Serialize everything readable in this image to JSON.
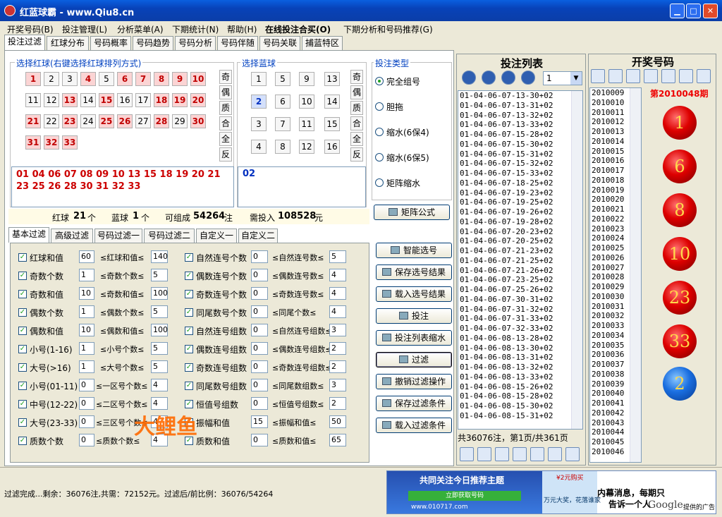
{
  "window": {
    "title": "红蓝球霸 - www.Qiu8.cn"
  },
  "menu": [
    "开奖号码(B)",
    "投注管理(L)",
    "分析菜单(A)",
    "下期统计(N)",
    "帮助(H)",
    "在线投注合买(O)",
    "下期分析和号码推荐(G)"
  ],
  "tabs": [
    "投注过滤",
    "红球分布",
    "号码概率",
    "号码趋势",
    "号码分析",
    "号码伴随",
    "号码关联",
    "捕蓝特区"
  ],
  "red_section": {
    "label": "选择红球(右键选择红球排列方式)",
    "numbers": [
      "1",
      "2",
      "3",
      "4",
      "5",
      "6",
      "7",
      "8",
      "9",
      "10",
      "11",
      "12",
      "13",
      "14",
      "15",
      "16",
      "17",
      "18",
      "19",
      "20",
      "21",
      "22",
      "23",
      "24",
      "25",
      "26",
      "27",
      "28",
      "29",
      "30",
      "31",
      "32",
      "33"
    ],
    "selected": [
      1,
      4,
      6,
      7,
      8,
      9,
      10,
      13,
      15,
      18,
      19,
      20,
      21,
      23,
      25,
      26,
      28,
      30,
      31,
      32,
      33
    ],
    "side_buttons": [
      "奇",
      "偶",
      "质",
      "合",
      "全",
      "反"
    ],
    "selected_text": "01 04 06 07 08 09 10 13 15 18 19 20 21 23 25 26 28 30 31 32 33"
  },
  "blue_section": {
    "label": "选择蓝球",
    "numbers": [
      "1",
      "5",
      "9",
      "13",
      "2",
      "6",
      "10",
      "14",
      "3",
      "7",
      "11",
      "15",
      "4",
      "8",
      "12",
      "16"
    ],
    "selected": [
      2
    ],
    "side_buttons": [
      "奇",
      "偶",
      "质",
      "合",
      "全",
      "反"
    ],
    "selected_text": "02"
  },
  "summary": {
    "red_label": "红球",
    "red_count": "21",
    "blue_label": "蓝球",
    "blue_count": "1",
    "unit_ge": "个",
    "combo_label": "可组成",
    "combo_count": "54264",
    "unit_zhu": "注",
    "need_label": "需投入",
    "need_amount": "108528",
    "unit_yuan": "元"
  },
  "bet_type": {
    "label": "投注类型",
    "options": [
      "完全组号",
      "胆拖",
      "缩水(6保4)",
      "缩水(6保5)",
      "矩阵缩水"
    ],
    "selected": 0,
    "matrix_button": "矩阵公式"
  },
  "filter_tabs": [
    "基本过滤",
    "高级过滤",
    "号码过滤一",
    "号码过滤二",
    "自定义一",
    "自定义二"
  ],
  "filters_left": [
    {
      "name": "红球和值",
      "min": "60",
      "mid": "≤红球和值≤",
      "max": "140"
    },
    {
      "name": "奇数个数",
      "min": "1",
      "mid": "≤奇数个数≤",
      "max": "5"
    },
    {
      "name": "奇数和值",
      "min": "10",
      "mid": "≤奇数和值≤",
      "max": "100"
    },
    {
      "name": "偶数个数",
      "min": "1",
      "mid": "≤偶数个数≤",
      "max": "5"
    },
    {
      "name": "偶数和值",
      "min": "10",
      "mid": "≤偶数和值≤",
      "max": "100"
    },
    {
      "name": "小号(1-16)",
      "min": "1",
      "mid": "≤小号个数≤",
      "max": "5"
    },
    {
      "name": "大号(>16)",
      "min": "1",
      "mid": "≤大号个数≤",
      "max": "5"
    },
    {
      "name": "小号(01-11)",
      "min": "0",
      "mid": "≤一区号个数≤",
      "max": "4"
    },
    {
      "name": "中号(12-22)",
      "min": "0",
      "mid": "≤二区号个数≤",
      "max": "4"
    },
    {
      "name": "大号(23-33)",
      "min": "0",
      "mid": "≤三区号个数≤",
      "max": "4"
    },
    {
      "name": "质数个数",
      "min": "0",
      "mid": "≤质数个数≤",
      "max": "4"
    }
  ],
  "filters_right": [
    {
      "name": "自然连号个数",
      "min": "0",
      "mid": "≤自然连号数≤",
      "max": "5"
    },
    {
      "name": "偶数连号个数",
      "min": "0",
      "mid": "≤偶数连号数≤",
      "max": "4"
    },
    {
      "name": "奇数连号个数",
      "min": "0",
      "mid": "≤奇数连号数≤",
      "max": "4"
    },
    {
      "name": "同尾数号个数",
      "min": "0",
      "mid": "≤同尾个数≤",
      "max": "4"
    },
    {
      "name": "自然连号组数",
      "min": "0",
      "mid": "≤自然连号组数≤",
      "max": "3"
    },
    {
      "name": "偶数连号组数",
      "min": "0",
      "mid": "≤偶数连号组数≤",
      "max": "2"
    },
    {
      "name": "奇数连号组数",
      "min": "0",
      "mid": "≤奇数连号组数≤",
      "max": "2"
    },
    {
      "name": "同尾数号组数",
      "min": "0",
      "mid": "≤同尾数组数≤",
      "max": "3"
    },
    {
      "name": "恒值号组数",
      "min": "0",
      "mid": "≤恒值号组数≤",
      "max": "2"
    },
    {
      "name": "振幅和值",
      "min": "15",
      "mid": "≤振幅和值≤",
      "max": "50"
    },
    {
      "name": "质数和值",
      "min": "0",
      "mid": "≤质数和值≤",
      "max": "65"
    }
  ],
  "action_buttons": [
    "智能选号",
    "保存选号结果",
    "载入选号结果",
    "投注",
    "投注列表缩水",
    "过滤",
    "撤销过滤操作",
    "保存过滤条件",
    "载入过滤条件"
  ],
  "watermark": "大鲤鱼",
  "bet_list": {
    "title": "投注列表",
    "page_select": "1",
    "items": [
      "01-04-06-07-13-30+02",
      "01-04-06-07-13-31+02",
      "01-04-06-07-13-32+02",
      "01-04-06-07-13-33+02",
      "01-04-06-07-15-28+02",
      "01-04-06-07-15-30+02",
      "01-04-06-07-15-31+02",
      "01-04-06-07-15-32+02",
      "01-04-06-07-15-33+02",
      "01-04-06-07-18-25+02",
      "01-04-06-07-19-23+02",
      "01-04-06-07-19-25+02",
      "01-04-06-07-19-26+02",
      "01-04-06-07-19-28+02",
      "01-04-06-07-20-23+02",
      "01-04-06-07-20-25+02",
      "01-04-06-07-21-23+02",
      "01-04-06-07-21-25+02",
      "01-04-06-07-21-26+02",
      "01-04-06-07-23-25+02",
      "01-04-06-07-25-26+02",
      "01-04-06-07-30-31+02",
      "01-04-06-07-31-32+02",
      "01-04-06-07-31-33+02",
      "01-04-06-07-32-33+02",
      "01-04-06-08-13-28+02",
      "01-04-06-08-13-30+02",
      "01-04-06-08-13-31+02",
      "01-04-06-08-13-32+02",
      "01-04-06-08-13-33+02",
      "01-04-06-08-15-26+02",
      "01-04-06-08-15-28+02",
      "01-04-06-08-15-30+02",
      "01-04-06-08-15-31+02"
    ],
    "footer": "共36076注，第1页/共361页"
  },
  "draw": {
    "title": "开奖号码",
    "period_label": "第2010048期",
    "periods": [
      "2010009",
      "2010010",
      "2010011",
      "2010012",
      "2010013",
      "2010014",
      "2010015",
      "2010016",
      "2010017",
      "2010018",
      "2010019",
      "2010020",
      "2010021",
      "2010022",
      "2010023",
      "2010024",
      "2010025",
      "2010026",
      "2010027",
      "2010028",
      "2010029",
      "2010030",
      "2010031",
      "2010032",
      "2010033",
      "2010034",
      "2010035",
      "2010036",
      "2010037",
      "2010038",
      "2010039",
      "2010040",
      "2010041",
      "2010042",
      "2010043",
      "2010044",
      "2010045",
      "2010046"
    ],
    "red_balls": [
      "1",
      "6",
      "8",
      "10",
      "23",
      "33"
    ],
    "blue_ball": "2"
  },
  "status": "过滤完成...剩余：36076注,共需：72152元。过滤后/前比例：36076/54264",
  "ad": {
    "left_title": "共同关注今日推荐主题",
    "left_button": "立即获取号码",
    "left_url": "www.010717.com",
    "badge": "¥2元购买",
    "mid_text": "万元大奖，花落谁家",
    "right_line1": "内幕消息，每期只",
    "right_line2": "告诉一个人",
    "google": "Google",
    "google_suffix": "提供的广告"
  }
}
